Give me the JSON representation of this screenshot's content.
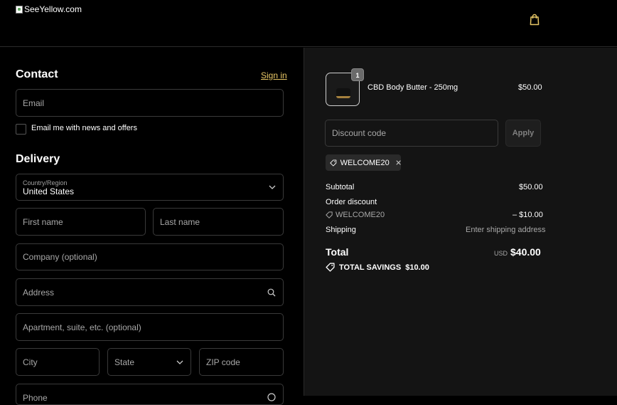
{
  "header": {
    "logo_alt": "SeeYellow.com",
    "bag_icon": "shopping-bag-icon"
  },
  "contact": {
    "title": "Contact",
    "sign_in": "Sign in",
    "email_placeholder": "Email",
    "newsletter_label": "Email me with news and offers"
  },
  "delivery": {
    "title": "Delivery",
    "country_label": "Country/Region",
    "country_value": "United States",
    "first_name": "First name",
    "last_name": "Last name",
    "company": "Company (optional)",
    "address": "Address",
    "apartment": "Apartment, suite, etc. (optional)",
    "city": "City",
    "state": "State",
    "zip": "ZIP code",
    "phone": "Phone"
  },
  "summary": {
    "item": {
      "name": "CBD Body Butter - 250mg",
      "price": "$50.00",
      "quantity": "1"
    },
    "discount_placeholder": "Discount code",
    "apply_label": "Apply",
    "applied_code": "WELCOME20",
    "subtotal_label": "Subtotal",
    "subtotal_value": "$50.00",
    "order_discount_label": "Order discount",
    "discount_code": "WELCOME20",
    "discount_value": "– $10.00",
    "shipping_label": "Shipping",
    "shipping_value": "Enter shipping address",
    "total_label": "Total",
    "currency": "USD",
    "total_value": "$40.00",
    "savings_label": "TOTAL SAVINGS",
    "savings_value": "$10.00"
  },
  "colors": {
    "accent": "#e8c766",
    "background": "#000000",
    "summary_bg": "#141414"
  }
}
